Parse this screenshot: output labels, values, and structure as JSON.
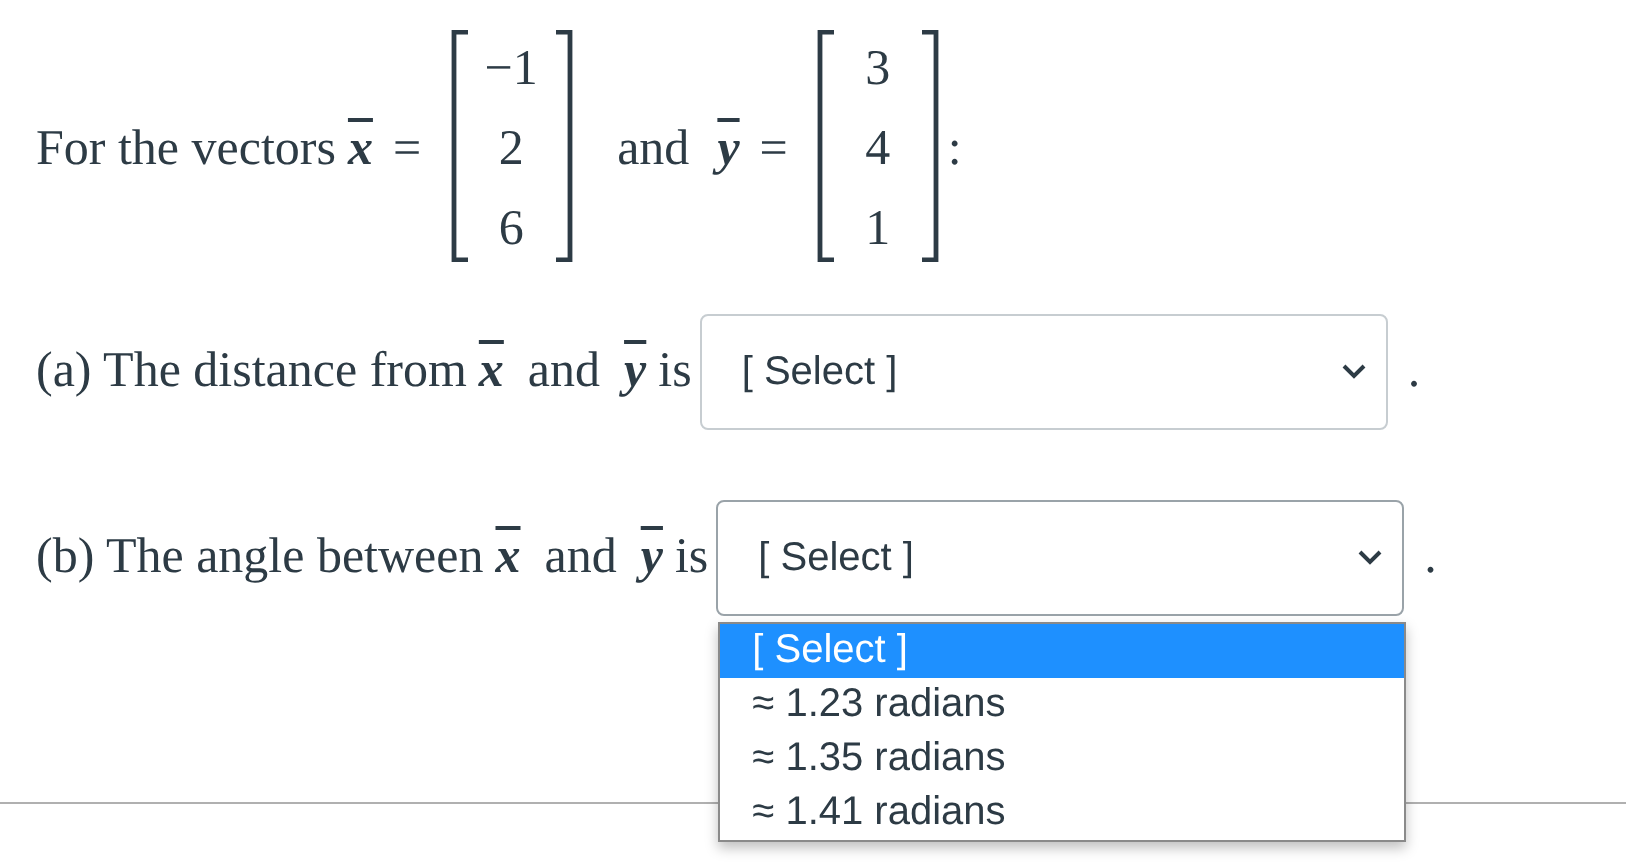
{
  "statement": {
    "lead": "For the vectors",
    "conjunction": "and",
    "end": ":",
    "vectors": [
      {
        "symbol": "x",
        "equals": "=",
        "entries": [
          "−1",
          "2",
          "6"
        ]
      },
      {
        "symbol": "y",
        "equals": "=",
        "entries": [
          "3",
          "4",
          "1"
        ]
      }
    ]
  },
  "questions": [
    {
      "prefix": "(a) The distance from",
      "first": "x",
      "conjunction": "and",
      "second": "y",
      "verb": "is",
      "select": {
        "value": "[ Select ]",
        "expanded": false
      },
      "end": "."
    },
    {
      "prefix": "(b) The angle between",
      "first": "x",
      "conjunction": "and",
      "second": "y",
      "verb": "is",
      "select": {
        "value": "[ Select ]",
        "expanded": true,
        "options": [
          {
            "label": "[ Select ]",
            "selected": true
          },
          {
            "label": "≈ 1.23 radians",
            "selected": false
          },
          {
            "label": "≈ 1.35 radians",
            "selected": false
          },
          {
            "label": "≈ 1.41 radians",
            "selected": false
          }
        ]
      },
      "end": "."
    }
  ]
}
